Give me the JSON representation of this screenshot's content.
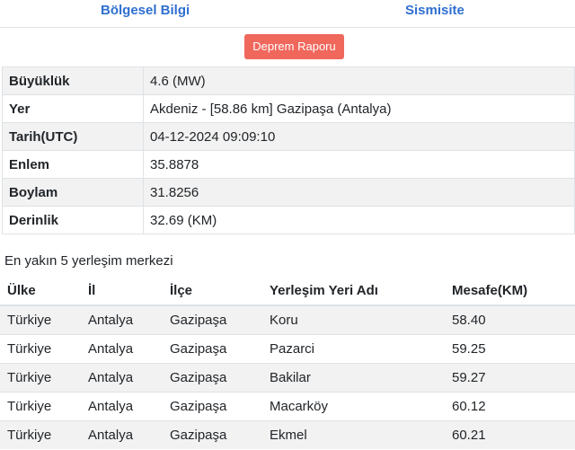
{
  "tabs": {
    "regional": "Bölgesel Bilgi",
    "seismicity": "Sismisite"
  },
  "report_button": "Deprem Raporu",
  "info": [
    {
      "label": "Büyüklük",
      "value": "4.6 (MW)"
    },
    {
      "label": "Yer",
      "value": "Akdeniz - [58.86 km] Gazipaşa (Antalya)"
    },
    {
      "label": "Tarih(UTC)",
      "value": "04-12-2024 09:09:10"
    },
    {
      "label": "Enlem",
      "value": "35.8878"
    },
    {
      "label": "Boylam",
      "value": "31.8256"
    },
    {
      "label": "Derinlik",
      "value": "32.69 (KM)"
    }
  ],
  "nearby": {
    "title": "En yakın 5 yerleşim merkezi",
    "headers": [
      "Ülke",
      "İl",
      "İlçe",
      "Yerleşim Yeri Adı",
      "Mesafe(KM)"
    ],
    "rows": [
      [
        "Türkiye",
        "Antalya",
        "Gazipaşa",
        "Koru",
        "58.40"
      ],
      [
        "Türkiye",
        "Antalya",
        "Gazipaşa",
        "Pazarci",
        "59.25"
      ],
      [
        "Türkiye",
        "Antalya",
        "Gazipaşa",
        "Bakilar",
        "59.27"
      ],
      [
        "Türkiye",
        "Antalya",
        "Gazipaşa",
        "Macarköy",
        "60.12"
      ],
      [
        "Türkiye",
        "Antalya",
        "Gazipaşa",
        "Ekmel",
        "60.21"
      ]
    ]
  },
  "colors": {
    "link": "#2f6fd0",
    "button": "#f0675c",
    "stripe": "#f2f2f2"
  }
}
